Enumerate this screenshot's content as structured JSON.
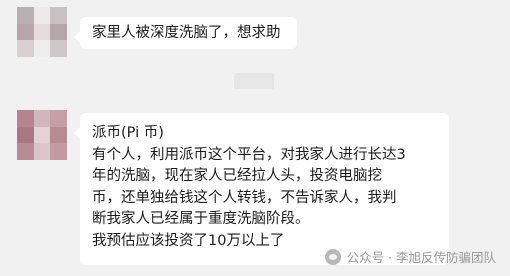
{
  "chat": {
    "avatar_colors": {
      "a": [
        "#b9b0b2",
        "#efe8e9",
        "#c9c0c2",
        "#b7a5a7",
        "#e7dcdd",
        "#b4a7a9",
        "#d8cfd0",
        "#f0ecec",
        "#cfc8c9"
      ],
      "b": [
        "#b5858d",
        "#cfb7bb",
        "#c4a0a6",
        "#a97981",
        "#e3d2d4",
        "#b88a91",
        "#b78d94",
        "#dbc5c8",
        "#c39aa0"
      ]
    },
    "messages": [
      {
        "lines": [
          "家里人被深度洗脑了，想求助"
        ]
      },
      {
        "lines": [
          "派币(Pi 币)",
          "有个人，利用派币这个平台，对我家人进行长达3",
          "年的洗脑，现在家人已经拉人头，投资电脑挖",
          "币，还单独给钱这个人转钱，不告诉家人，我判",
          "断我家人已经属于重度洗脑阶段。",
          "我预估应该投资了10万以上了"
        ]
      }
    ]
  },
  "watermark": {
    "text": "公众号 · 李旭反传防骗团队"
  }
}
